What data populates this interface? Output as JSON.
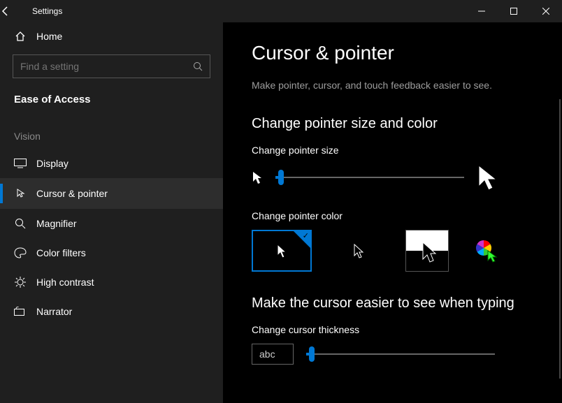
{
  "titlebar": {
    "title": "Settings"
  },
  "sidebar": {
    "home_label": "Home",
    "search_placeholder": "Find a setting",
    "section": "Ease of Access",
    "group": "Vision",
    "items": [
      {
        "label": "Display"
      },
      {
        "label": "Cursor & pointer"
      },
      {
        "label": "Magnifier"
      },
      {
        "label": "Color filters"
      },
      {
        "label": "High contrast"
      },
      {
        "label": "Narrator"
      }
    ]
  },
  "content": {
    "title": "Cursor & pointer",
    "desc": "Make pointer, cursor, and touch feedback easier to see.",
    "section1_title": "Change pointer size and color",
    "size_label": "Change pointer size",
    "color_label": "Change pointer color",
    "section2_title": "Make the cursor easier to see when typing",
    "thickness_label": "Change cursor thickness",
    "thickness_preview": "abc"
  }
}
